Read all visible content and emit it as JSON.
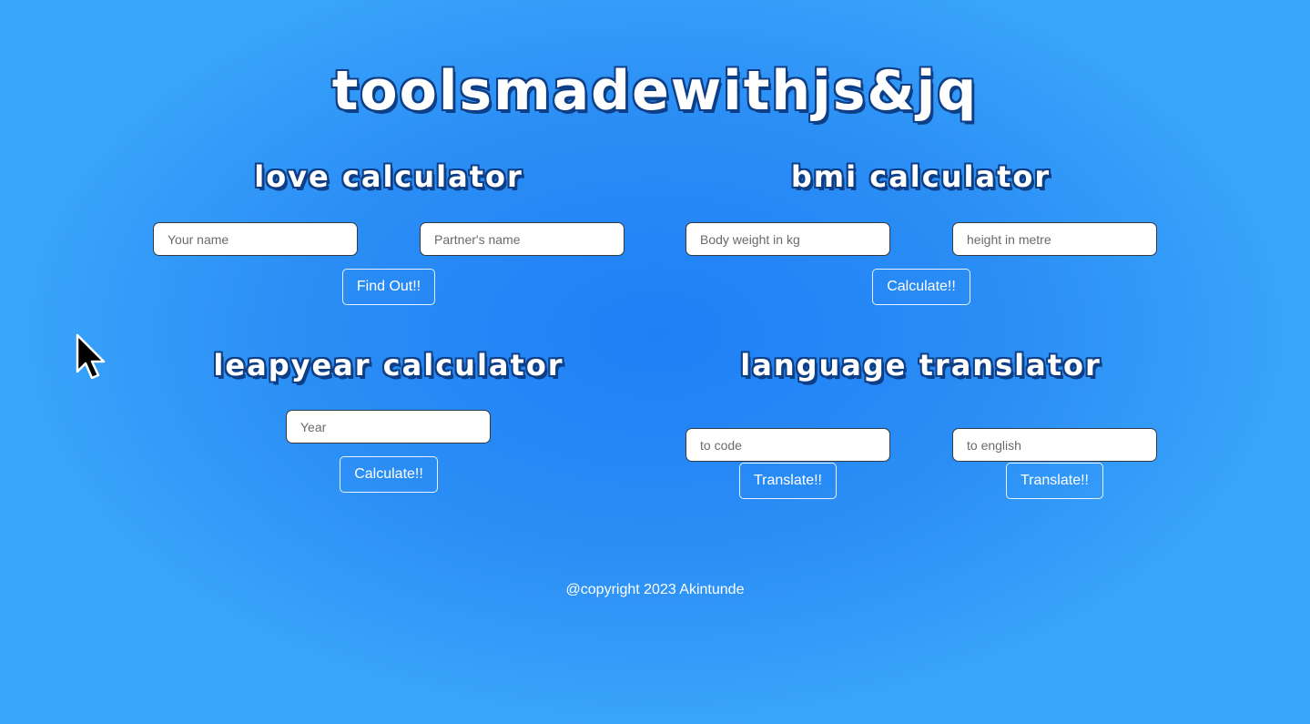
{
  "header": {
    "title": "toolsmadewithjs&jq"
  },
  "love_calculator": {
    "title": "love calculator",
    "your_name_placeholder": "Your name",
    "partner_name_placeholder": "Partner's name",
    "button_label": "Find Out!!"
  },
  "bmi_calculator": {
    "title": "bmi calculator",
    "weight_placeholder": "Body weight in kg",
    "height_placeholder": "height in metre",
    "button_label": "Calculate!!"
  },
  "leapyear_calculator": {
    "title": "leapyear calculator",
    "year_placeholder": "Year",
    "button_label": "Calculate!!"
  },
  "language_translator": {
    "title": "language translator",
    "to_code_placeholder": "to code",
    "to_english_placeholder": "to english",
    "to_code_button_label": "Translate!!",
    "to_english_button_label": "Translate!!"
  },
  "footer": {
    "copyright": "@copyright 2023 Akintunde"
  },
  "icons": {
    "cursor": "arrow-cursor-icon"
  }
}
